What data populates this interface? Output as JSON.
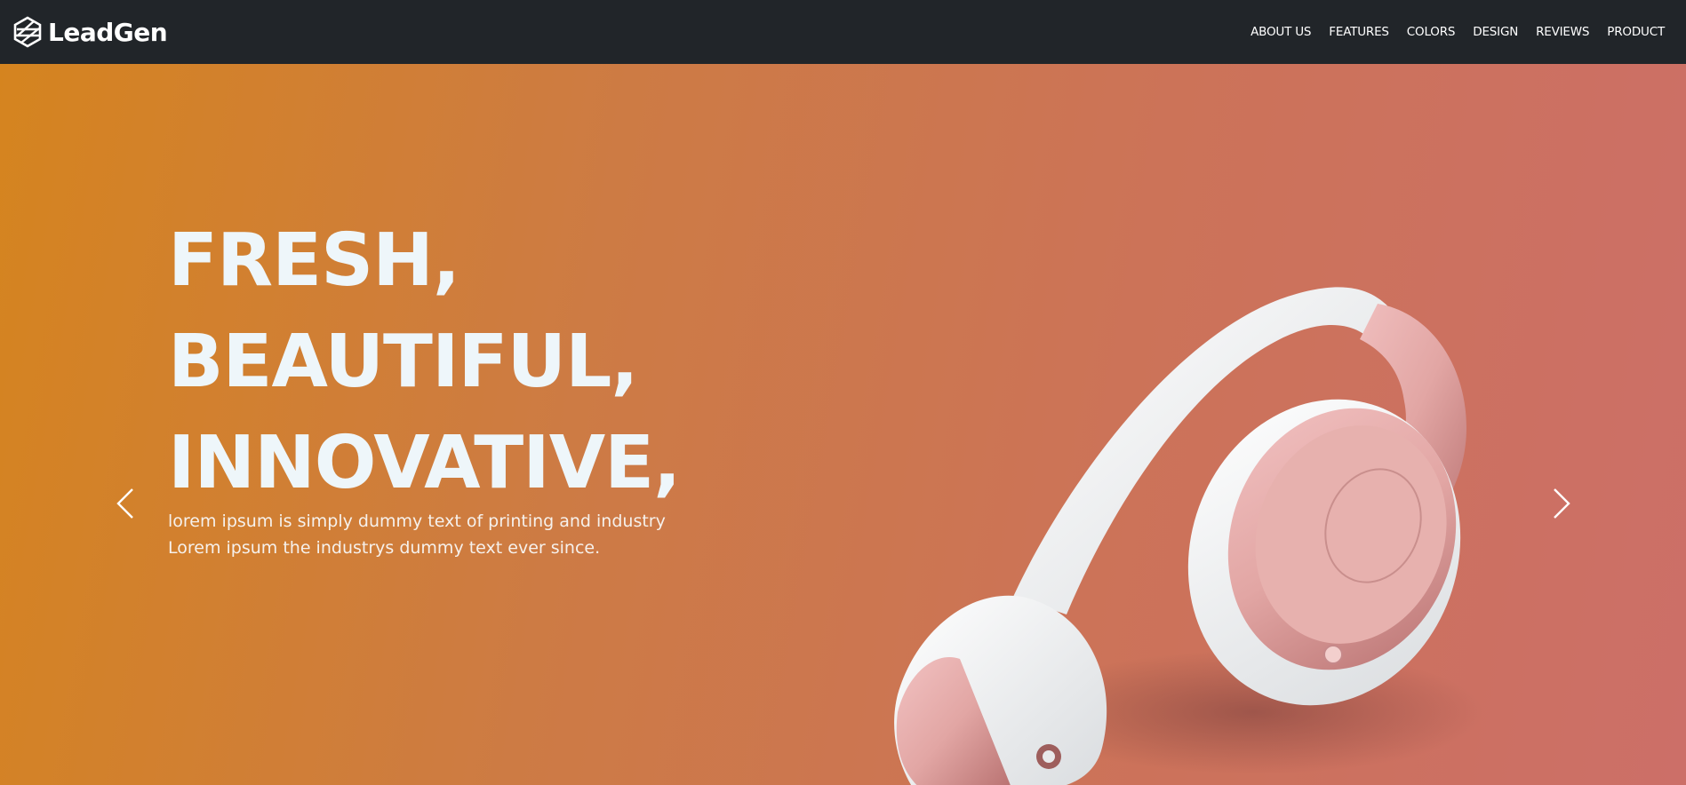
{
  "brand": {
    "name": "LeadGen",
    "logo_icon": "hexagon-logo-icon"
  },
  "nav": {
    "items": [
      {
        "label": "ABOUT US"
      },
      {
        "label": "FEATURES"
      },
      {
        "label": "COLORS"
      },
      {
        "label": "DESIGN"
      },
      {
        "label": "REVIEWS"
      },
      {
        "label": "PRODUCT"
      }
    ]
  },
  "hero": {
    "headline_lines": [
      "FRESH,",
      "BEAUTIFUL,",
      "INNOVATIVE,"
    ],
    "sub_lines": [
      "lorem ipsum is simply dummy text of printing and industry",
      "Lorem ipsum the industrys dummy text ever since."
    ],
    "prev_icon": "chevron-left-icon",
    "next_icon": "chevron-right-icon",
    "image": "rose-gold-headphones"
  },
  "colors": {
    "navbar": "#212529",
    "gradient_start": "#d5841f",
    "gradient_end": "#cc6f68",
    "headline": "#eef6fa"
  }
}
